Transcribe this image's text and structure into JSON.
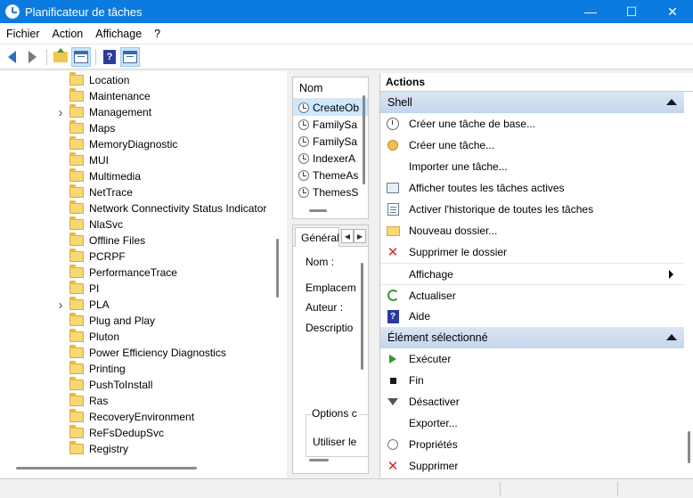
{
  "window": {
    "title": "Planificateur de tâches",
    "minimize": "—",
    "maximize": "☐",
    "close": "✕"
  },
  "menu": [
    "Fichier",
    "Action",
    "Affichage",
    "?"
  ],
  "toolbar": {
    "icons": [
      "back-arrow-icon",
      "forward-arrow-icon",
      "folder-up-icon",
      "show-hide-console-tree-icon",
      "help-icon",
      "show-hide-action-pane-icon"
    ]
  },
  "tree": {
    "items": [
      {
        "label": "Location",
        "expandable": false
      },
      {
        "label": "Maintenance",
        "expandable": false
      },
      {
        "label": "Management",
        "expandable": true
      },
      {
        "label": "Maps",
        "expandable": false
      },
      {
        "label": "MemoryDiagnostic",
        "expandable": false
      },
      {
        "label": "MUI",
        "expandable": false
      },
      {
        "label": "Multimedia",
        "expandable": false
      },
      {
        "label": "NetTrace",
        "expandable": false
      },
      {
        "label": "Network Connectivity Status Indicator",
        "expandable": false
      },
      {
        "label": "NlaSvc",
        "expandable": false
      },
      {
        "label": "Offline Files",
        "expandable": false
      },
      {
        "label": "PCRPF",
        "expandable": false
      },
      {
        "label": "PerformanceTrace",
        "expandable": false
      },
      {
        "label": "PI",
        "expandable": false
      },
      {
        "label": "PLA",
        "expandable": true
      },
      {
        "label": "Plug and Play",
        "expandable": false
      },
      {
        "label": "Pluton",
        "expandable": false
      },
      {
        "label": "Power Efficiency Diagnostics",
        "expandable": false
      },
      {
        "label": "Printing",
        "expandable": false
      },
      {
        "label": "PushToInstall",
        "expandable": false
      },
      {
        "label": "Ras",
        "expandable": false
      },
      {
        "label": "RecoveryEnvironment",
        "expandable": false
      },
      {
        "label": "ReFsDedupSvc",
        "expandable": false
      },
      {
        "label": "Registry",
        "expandable": false
      }
    ]
  },
  "tasks": {
    "column_header": "Nom",
    "rows": [
      "CreateOb",
      "FamilySa",
      "FamilySa",
      "IndexerA",
      "ThemeAs",
      "ThemesS"
    ]
  },
  "details": {
    "tab_label": "Général",
    "tab_prev": "◀",
    "tab_next": "▶",
    "name_label": "Nom :",
    "location_label": "Emplacem",
    "author_label": "Auteur :",
    "description_label": "Descriptio",
    "options_legend": "Options c",
    "use_label": "Utiliser le"
  },
  "actions": {
    "header": "Actions",
    "shell_section": "Shell",
    "shell_items": [
      {
        "label": "Créer une tâche de base...",
        "icon": "create-basic-task-icon"
      },
      {
        "label": "Créer une tâche...",
        "icon": "create-task-icon"
      },
      {
        "label": "Importer une tâche...",
        "icon": ""
      },
      {
        "label": "Afficher toutes les tâches actives",
        "icon": "active-tasks-icon"
      },
      {
        "label": "Activer l'historique de toutes les tâches",
        "icon": "history-icon"
      },
      {
        "label": "Nouveau dossier...",
        "icon": "new-folder-icon"
      },
      {
        "label": "Supprimer le dossier",
        "icon": "delete-icon"
      },
      {
        "label": "Affichage",
        "icon": "",
        "submenu": true
      },
      {
        "label": "Actualiser",
        "icon": "refresh-icon"
      },
      {
        "label": "Aide",
        "icon": "help-icon"
      }
    ],
    "selected_section": "Élément sélectionné",
    "selected_items": [
      {
        "label": "Exécuter",
        "icon": "run-icon"
      },
      {
        "label": "Fin",
        "icon": "stop-icon"
      },
      {
        "label": "Désactiver",
        "icon": "disable-icon"
      },
      {
        "label": "Exporter...",
        "icon": ""
      },
      {
        "label": "Propriétés",
        "icon": "properties-icon"
      },
      {
        "label": "Supprimer",
        "icon": "delete-icon"
      }
    ]
  },
  "colors": {
    "titlebar": "#0c7be0",
    "section_header": "#c4d5ec",
    "selection": "#cce8ff"
  }
}
